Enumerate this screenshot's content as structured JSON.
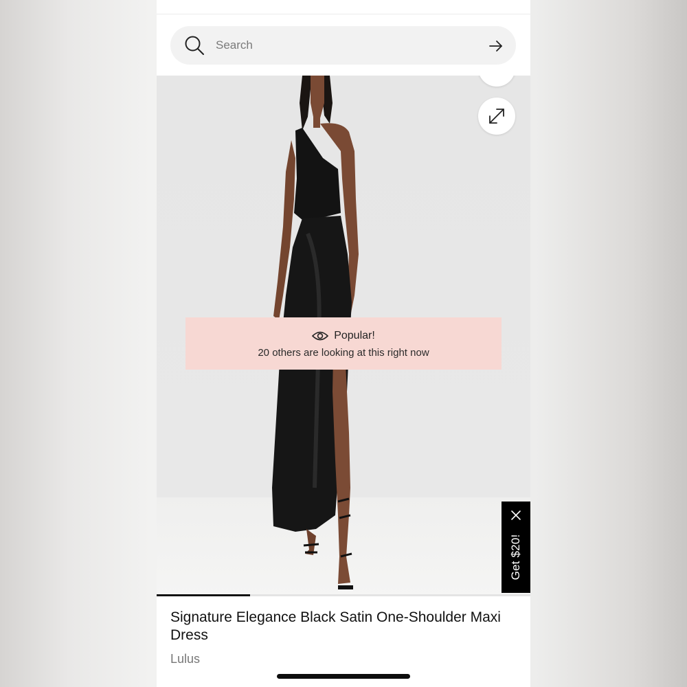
{
  "search": {
    "placeholder": "Search"
  },
  "icons": {
    "search": "search-icon",
    "submit": "arrow-right-icon",
    "expand": "expand-icon",
    "eye": "eye-icon",
    "close": "close-icon"
  },
  "popular_banner": {
    "heading": "Popular!",
    "message": "20 others are looking at this right now",
    "background": "#f7d8d3"
  },
  "promo_tab": {
    "label": "Get $20!",
    "background": "#000000"
  },
  "gallery": {
    "progress_fraction": 0.25
  },
  "product": {
    "title": "Signature Elegance Black Satin One-Shoulder Maxi Dress",
    "brand": "Lulus"
  }
}
